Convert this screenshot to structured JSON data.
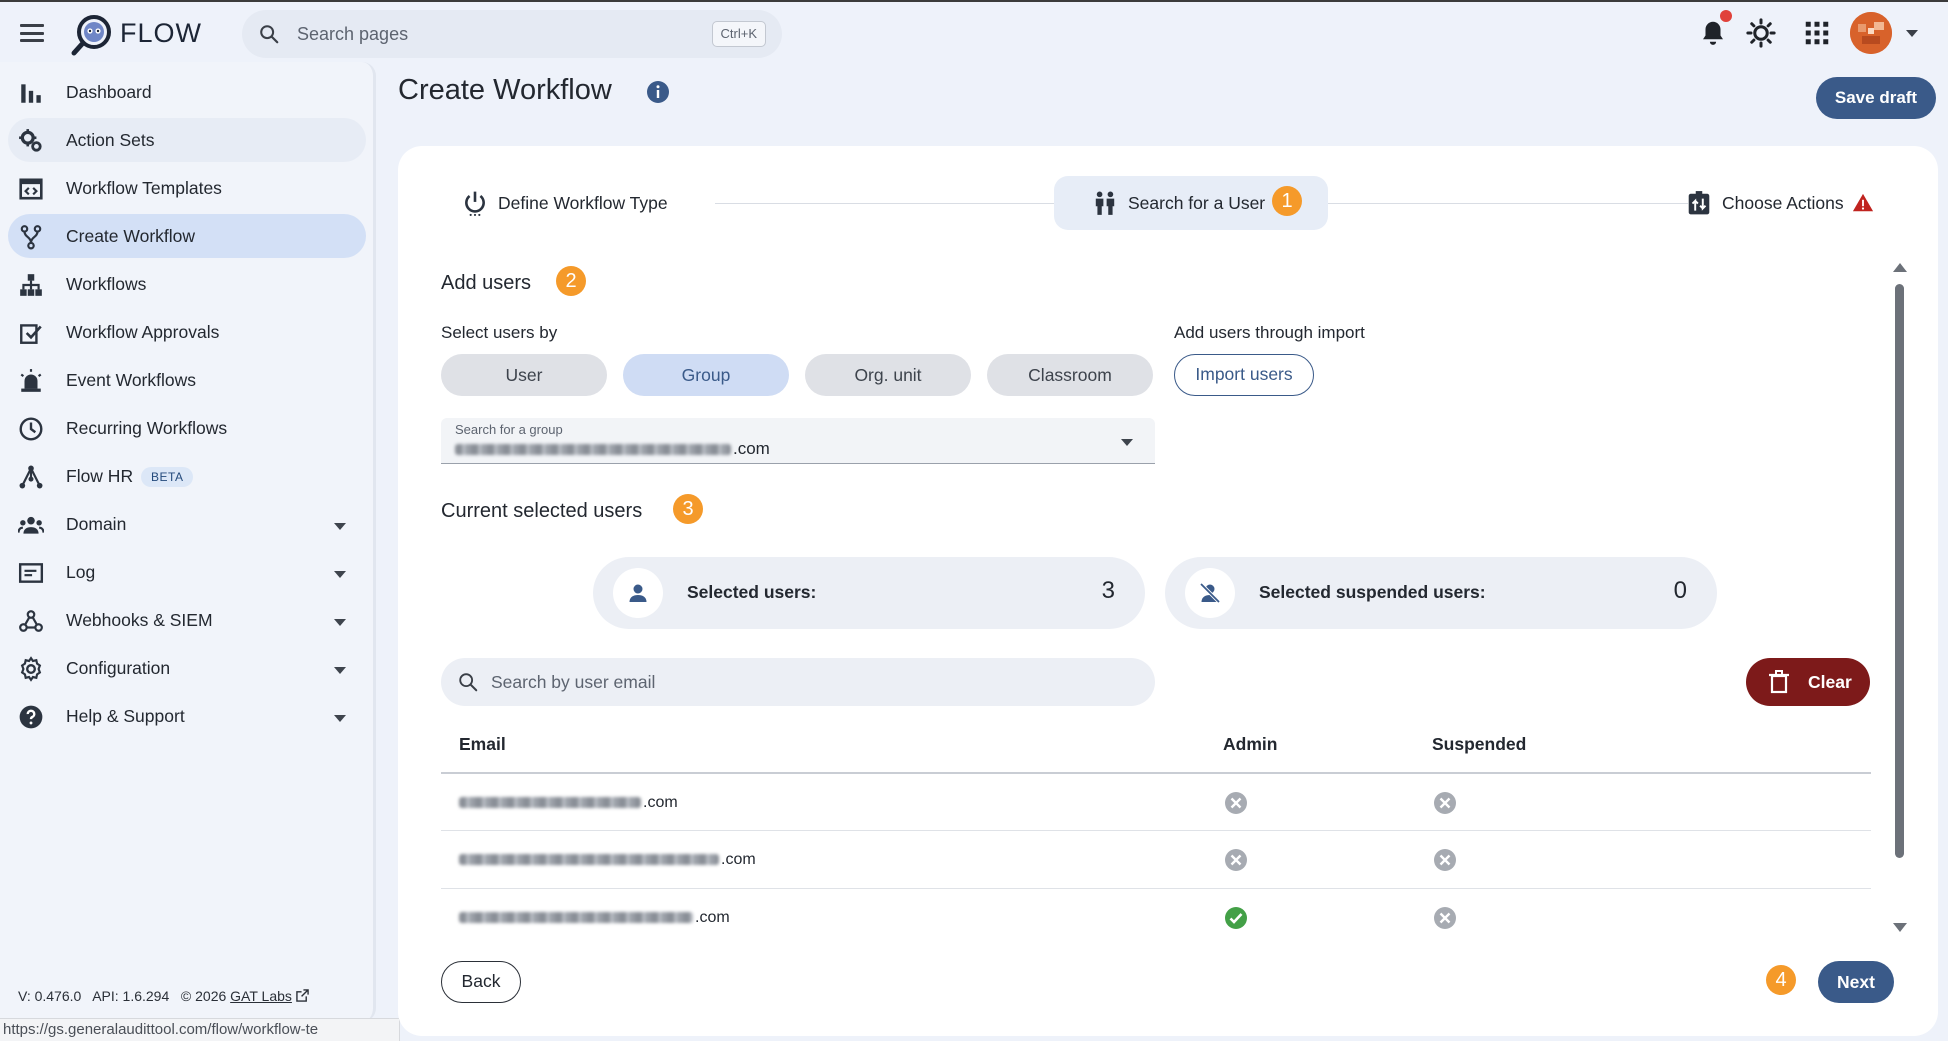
{
  "app": {
    "brand": "FLOW",
    "search_placeholder": "Search pages",
    "search_shortcut": "Ctrl+K"
  },
  "sidebar": {
    "items": [
      {
        "label": "Dashboard",
        "icon": "bar-chart-icon"
      },
      {
        "label": "Action Sets",
        "icon": "gears-icon"
      },
      {
        "label": "Workflow Templates",
        "icon": "code-window-icon"
      },
      {
        "label": "Create Workflow",
        "icon": "fork-icon"
      },
      {
        "label": "Workflows",
        "icon": "sitemap-icon"
      },
      {
        "label": "Workflow Approvals",
        "icon": "checklist-icon"
      },
      {
        "label": "Event Workflows",
        "icon": "siren-icon"
      },
      {
        "label": "Recurring Workflows",
        "icon": "clock-icon"
      },
      {
        "label": "Flow HR",
        "icon": "hierarchy-icon",
        "badge": "BETA"
      },
      {
        "label": "Domain",
        "icon": "people-icon"
      },
      {
        "label": "Log",
        "icon": "log-icon"
      },
      {
        "label": "Webhooks & SIEM",
        "icon": "webhook-icon"
      },
      {
        "label": "Configuration",
        "icon": "gear-icon"
      },
      {
        "label": "Help & Support",
        "icon": "help-icon"
      }
    ],
    "active_item": "Create Workflow",
    "version": "V: 0.476.0   API: 1.6.294   © 2026",
    "company_link": "GAT Labs"
  },
  "status_url": "https://gs.generalaudittool.com/flow/workflow-te",
  "page": {
    "title": "Create Workflow",
    "save_draft": "Save draft"
  },
  "stepper": {
    "steps": [
      {
        "label": "Define Workflow Type"
      },
      {
        "label": "Search for a User"
      },
      {
        "label": "Choose Actions"
      }
    ],
    "current_step": "Search for a User"
  },
  "badges": [
    "1",
    "2",
    "3",
    "4"
  ],
  "add_users": {
    "title": "Add users",
    "select_by_label": "Select users by",
    "options": [
      "User",
      "Group",
      "Org. unit",
      "Classroom"
    ],
    "selected_option": "Group",
    "import_label": "Add users through import",
    "import_button": "Import users",
    "group_field_label": "Search for a group",
    "group_field_value_suffix": ".com"
  },
  "selection": {
    "title": "Current selected users",
    "selected_users_label": "Selected users:",
    "selected_users_count": "3",
    "suspended_users_label": "Selected suspended users:",
    "suspended_users_count": "0"
  },
  "email_search_placeholder": "Search by user email",
  "clear_button": "Clear",
  "table": {
    "headers": [
      "Email",
      "Admin",
      "Suspended"
    ],
    "rows": [
      {
        "email_suffix": ".com",
        "admin": false,
        "suspended": false
      },
      {
        "email_suffix": ".com",
        "admin": false,
        "suspended": false
      },
      {
        "email_suffix": ".com",
        "admin": true,
        "suspended": false
      }
    ]
  },
  "footer": {
    "back": "Back",
    "next": "Next"
  },
  "colors": {
    "primary": "#3a5a89",
    "danger": "#7d1a1a",
    "badge": "#f59a2a",
    "success": "#43a047",
    "neutral_icon": "#a7abb2"
  }
}
